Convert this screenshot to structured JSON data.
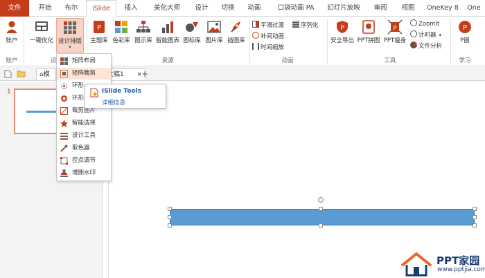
{
  "tabs": [
    {
      "label": "文件"
    },
    {
      "label": "开始"
    },
    {
      "label": "布尔"
    },
    {
      "label": "iSlide"
    },
    {
      "label": "插入"
    },
    {
      "label": "美化大师"
    },
    {
      "label": "设计"
    },
    {
      "label": "切换"
    },
    {
      "label": "动画"
    },
    {
      "label": "口袋动画 PA"
    },
    {
      "label": "幻灯片放映"
    },
    {
      "label": "审阅"
    },
    {
      "label": "视图"
    },
    {
      "label": "OneKey 8"
    },
    {
      "label": "One"
    }
  ],
  "ribbon": {
    "account": "账户",
    "optimize": "一键优化",
    "design_layout": "设计排版",
    "theme_lib": "主题库",
    "color_lib": "色彩库",
    "diagram_lib": "图示库",
    "smart_chart": "智能图表",
    "icon_lib": "图标库",
    "picture_lib": "图片库",
    "illustration_lib": "插图库",
    "smooth_transition": "平滑过渡",
    "sequence": "序列化",
    "tween_anim": "补间动画",
    "time_scale": "时间缩放",
    "safe_export": "安全导出",
    "ppt_collage": "PPT拼图",
    "ppt_slim": "PPT瘦身",
    "zoomit": "ZoomIt",
    "timer": "计时器",
    "file_analysis": "文件分析",
    "pcircle": "P圈",
    "groups": {
      "account": "账户",
      "design": "设",
      "resources": "资源",
      "animation": "动画",
      "tools": "工具",
      "learn": "学习"
    }
  },
  "menu": {
    "items": [
      {
        "label": "矩阵布局"
      },
      {
        "label": "矩阵裁剪"
      },
      {
        "label": "环形"
      },
      {
        "label": "环形"
      },
      {
        "label": "裁剪图片"
      },
      {
        "label": "智能选择"
      },
      {
        "label": "设计工具"
      },
      {
        "label": "取色器"
      },
      {
        "label": "控点调节"
      },
      {
        "label": "增删水印"
      }
    ]
  },
  "tooltip": {
    "title": "iSlide Tools",
    "subtitle": "详细信息"
  },
  "docstrip": {
    "tab_left": "模",
    "tab_doc": "文稿1",
    "close": "×",
    "add": "+"
  },
  "slides": {
    "number": "1"
  },
  "watermark": {
    "name": "PPT家园",
    "url": "www.pptjia.com"
  },
  "colors": {
    "accent": "#c43e1c",
    "shape_fill": "#5b9bd5",
    "link_blue": "#1e5ba8"
  }
}
